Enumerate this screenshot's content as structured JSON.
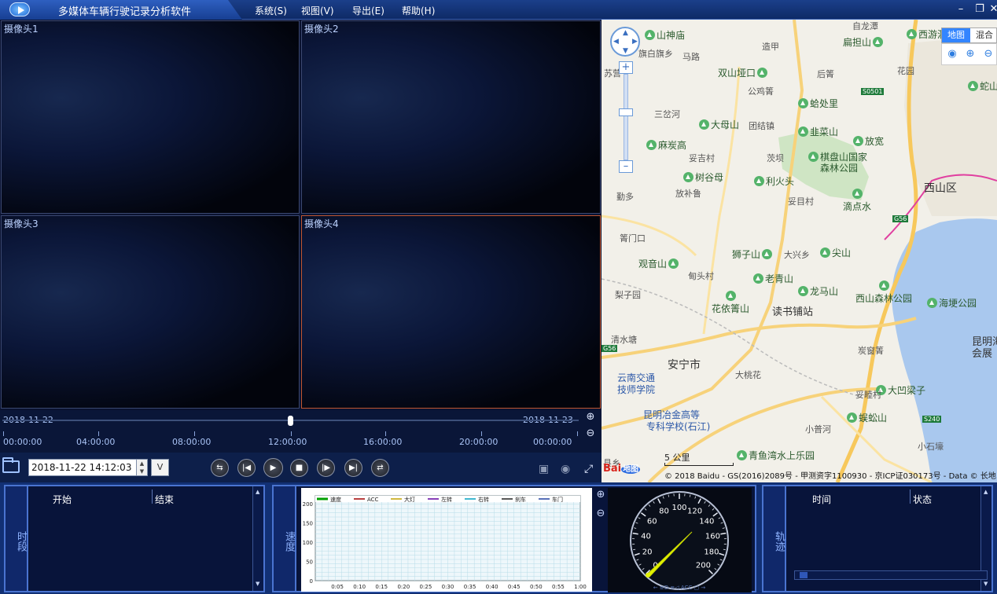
{
  "app": {
    "title": "多媒体车辆行驶记录分析软件",
    "menu": [
      "系统(S)",
      "视图(V)",
      "导出(E)",
      "帮助(H)"
    ]
  },
  "cameras": [
    {
      "label": "摄像头1"
    },
    {
      "label": "摄像头2"
    },
    {
      "label": "摄像头3"
    },
    {
      "label": "摄像头4"
    }
  ],
  "timeline": {
    "start_date": "2018-11-22",
    "end_date": "2018-11-23",
    "hours": [
      "00:00:00",
      "04:00:00",
      "08:00:00",
      "12:00:00",
      "16:00:00",
      "20:00:00",
      "00:00:00"
    ],
    "position": 0.5
  },
  "controls": {
    "datetime": "2018-11-22 14:12:03",
    "dropdown": "V"
  },
  "map": {
    "type_map": "地图",
    "type_mix": "混合",
    "scale": "5 公里",
    "baidu": "Bai",
    "baidu2": "地图",
    "copyright": "© 2018 Baidu - GS(2016)2089号 - 甲测资字1100930 - 京ICP证030173号 - Data © 长地",
    "pois": [
      "山神庙",
      "扁担山",
      "西游洞",
      "双山垭口",
      "蛤处里",
      "韭菜山",
      "放宽",
      "大母山",
      "麻炭高",
      "树谷母",
      "棋盘山国家",
      "森林公园",
      "利火头",
      "滴点水",
      "观音山",
      "狮子山",
      "尖山",
      "老青山",
      "龙马山",
      "花依箐山",
      "西山森林公园",
      "海埂公园",
      "大凹梁子",
      "蜈蚣山",
      "蛇山",
      "青鱼湾水上乐园",
      "自龙潭"
    ],
    "places": [
      "旗白旗乡",
      "马路",
      "苏营",
      "造甲",
      "后箐",
      "花园",
      "公鸡箐",
      "团结镇",
      "三岔河",
      "妥吉村",
      "茨坝",
      "勤多",
      "放补鲁",
      "妥目村",
      "箐门口",
      "大兴乡",
      "甸头村",
      "梨子园",
      "清水塘",
      "大桃花",
      "炭窗箐",
      "妥睦村",
      "小普河",
      "小石壕",
      "县乡"
    ],
    "city_labels": [
      "西山区",
      "安宁市",
      "读书铺站",
      "昆明海",
      "会展"
    ],
    "schools": [
      "云南交通",
      "技师学院",
      "昆明冶金高等",
      "专科学校(石江)"
    ],
    "roads": [
      "S0501",
      "G56",
      "G56",
      "S240"
    ]
  },
  "segments": {
    "vlabel": "时段",
    "col_start": "开始",
    "col_end": "结束"
  },
  "speed": {
    "vlabel": "速度",
    "legend": [
      "速度",
      "ACC",
      "大灯",
      "左转",
      "右转",
      "刹车",
      "车门"
    ],
    "y_ticks": [
      "200",
      "150",
      "100",
      "50",
      "0"
    ],
    "x_ticks": [
      "0:05",
      "0:10",
      "0:15",
      "0:20",
      "0:25",
      "0:30",
      "0:35",
      "0:40",
      "0:45",
      "0:50",
      "0:55",
      "1:00"
    ]
  },
  "gauge": {
    "labels": [
      "0",
      "20",
      "40",
      "60",
      "80",
      "100",
      "120",
      "140",
      "160",
      "180",
      "200"
    ],
    "value": 0,
    "bottom_text": "ACC"
  },
  "track": {
    "vlabel": "轨迹",
    "col_time": "时间",
    "col_status": "状态"
  },
  "colors": {
    "accent": "#4a74d0",
    "legend_colors": [
      "#00a000",
      "#a00000",
      "#c0a000",
      "#6000a0",
      "#00a0c0",
      "#202020",
      "#2040a0"
    ]
  }
}
